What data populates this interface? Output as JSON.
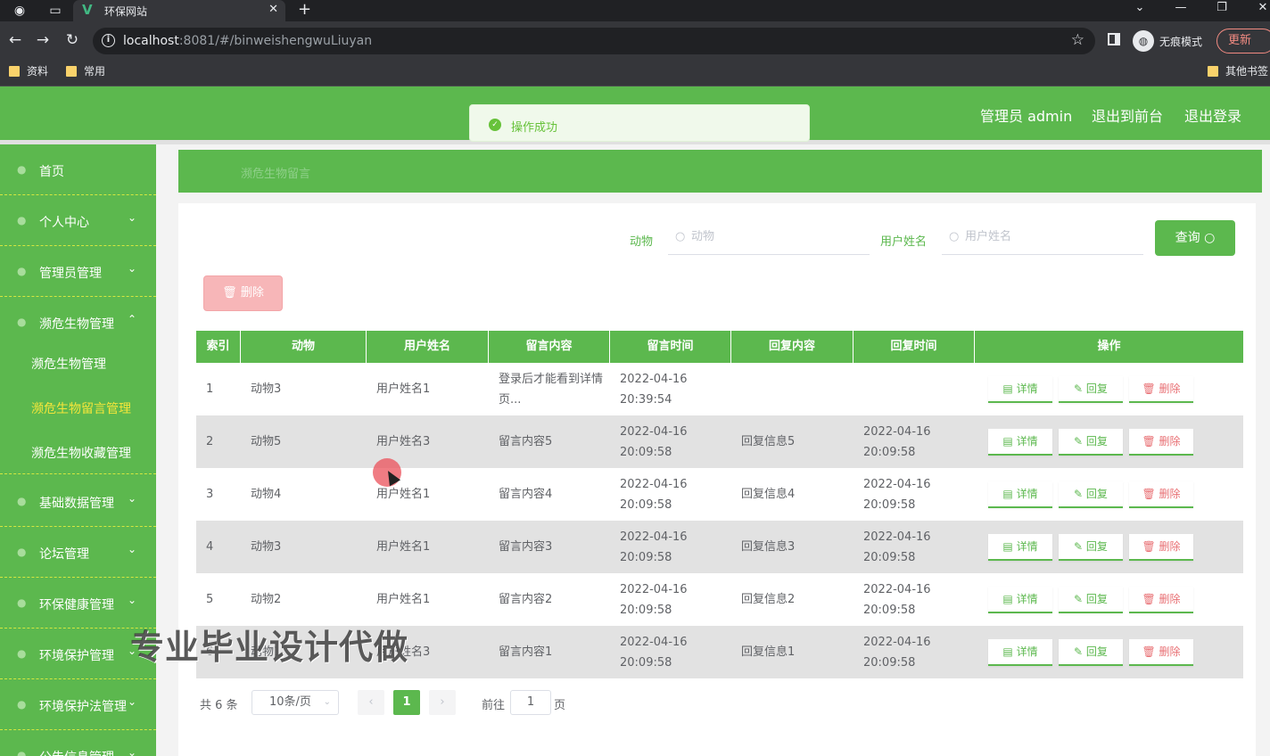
{
  "browser": {
    "tab_title": "环保网站",
    "url_host": "localhost",
    "url_rest": ":8081/#/binweishengwuLiuyan",
    "incognito_label": "无痕模式",
    "update_label": "更新",
    "bookmarks": [
      "资料",
      "常用"
    ],
    "other_bookmarks": "其他书签"
  },
  "header": {
    "admin_label": "管理员 admin",
    "front_label": "退出到前台",
    "logout_label": "退出登录"
  },
  "toast": {
    "text": "操作成功"
  },
  "sidebar": {
    "items": [
      {
        "label": "首页",
        "arrow": ""
      },
      {
        "label": "个人中心",
        "arrow": "⌄"
      },
      {
        "label": "管理员管理",
        "arrow": "⌄"
      },
      {
        "label": "濒危生物管理",
        "arrow": "⌃"
      }
    ],
    "sub_items": [
      "濒危生物管理",
      "濒危生物留言管理",
      "濒危生物收藏管理"
    ],
    "items_after": [
      {
        "label": "基础数据管理",
        "arrow": "⌄"
      },
      {
        "label": "论坛管理",
        "arrow": "⌄"
      },
      {
        "label": "环保健康管理",
        "arrow": "⌄"
      },
      {
        "label": "环境保护管理",
        "arrow": "⌄"
      },
      {
        "label": "环境保护法管理",
        "arrow": "⌄"
      },
      {
        "label": "公告信息管理",
        "arrow": "⌄"
      }
    ]
  },
  "breadcrumb": "濒危生物留言",
  "search": {
    "animal_label": "动物",
    "animal_placeholder": "动物",
    "user_label": "用户姓名",
    "user_placeholder": "用户姓名",
    "query_label": "查询"
  },
  "delete_label": "删除",
  "table": {
    "headers": [
      "索引",
      "动物",
      "用户姓名",
      "留言内容",
      "留言时间",
      "回复内容",
      "回复时间",
      "操作"
    ],
    "rows": [
      {
        "idx": "1",
        "animal": "动物3",
        "user": "用户姓名1",
        "content": "登录后才能看到详情页...",
        "time": "2022-04-16 20:39:54",
        "reply": "",
        "reply_time": ""
      },
      {
        "idx": "2",
        "animal": "动物5",
        "user": "用户姓名3",
        "content": "留言内容5",
        "time": "2022-04-16 20:09:58",
        "reply": "回复信息5",
        "reply_time": "2022-04-16 20:09:58"
      },
      {
        "idx": "3",
        "animal": "动物4",
        "user": "用户姓名1",
        "content": "留言内容4",
        "time": "2022-04-16 20:09:58",
        "reply": "回复信息4",
        "reply_time": "2022-04-16 20:09:58"
      },
      {
        "idx": "4",
        "animal": "动物3",
        "user": "用户姓名1",
        "content": "留言内容3",
        "time": "2022-04-16 20:09:58",
        "reply": "回复信息3",
        "reply_time": "2022-04-16 20:09:58"
      },
      {
        "idx": "5",
        "animal": "动物2",
        "user": "用户姓名1",
        "content": "留言内容2",
        "time": "2022-04-16 20:09:58",
        "reply": "回复信息2",
        "reply_time": "2022-04-16 20:09:58"
      },
      {
        "idx": "6",
        "animal": "动物1",
        "user": "用户姓名3",
        "content": "留言内容1",
        "time": "2022-04-16 20:09:58",
        "reply": "回复信息1",
        "reply_time": "2022-04-16 20:09:58"
      }
    ],
    "actions": {
      "detail": "详情",
      "reply": "回复",
      "delete": "删除"
    }
  },
  "pager": {
    "total": "共 6 条",
    "page_size": "10条/页",
    "current": "1",
    "goto_label": "前往",
    "goto_value": "1",
    "page_label": "页"
  },
  "watermark": "专业毕业设计代做",
  "colors": {
    "primary": "#5cb84e",
    "active_sub": "#f5e63a",
    "danger": "#e86f73"
  }
}
